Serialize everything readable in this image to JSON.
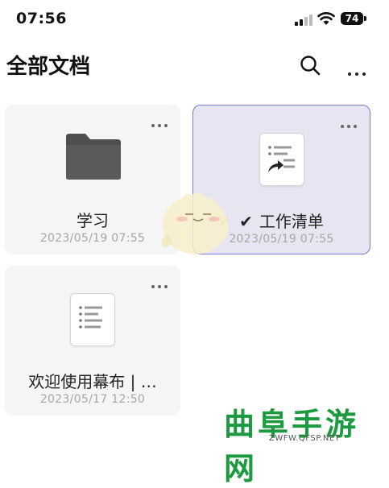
{
  "status": {
    "time": "07:56",
    "battery": "74"
  },
  "header": {
    "title": "全部文档"
  },
  "cards": [
    {
      "name": "学习",
      "date": "2023/05/19 07:55"
    },
    {
      "name": "工作清单",
      "date": "2023/05/19 07:55",
      "checkmark": "✔"
    },
    {
      "name": "欢迎使用幕布 | …",
      "date": "2023/05/17 12:50"
    }
  ],
  "watermark": {
    "text": "曲阜手游网",
    "url": "ZWFW.QFSP.NET"
  },
  "colors": {
    "accent": "#7a78d8",
    "selected_bg": "#e6e6f3",
    "card_bg": "#f5f5f5",
    "folder": "#505050",
    "watermark": "#1c9a3f"
  },
  "icons": [
    "signal-icon",
    "wifi-icon",
    "battery-icon",
    "search-icon",
    "more-icon",
    "folder-icon",
    "document-icon",
    "share-arrow-icon",
    "check-icon",
    "mascot-icon"
  ]
}
